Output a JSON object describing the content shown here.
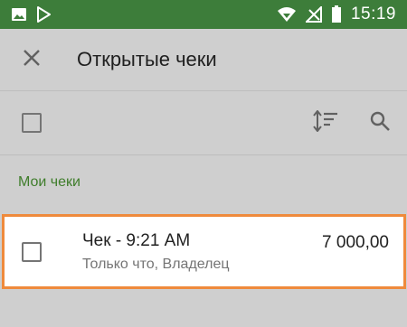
{
  "status_bar": {
    "time": "15:19",
    "icons_left": [
      "image-icon",
      "play-store-icon"
    ],
    "icons_right": [
      "wifi-icon",
      "no-signal-icon",
      "battery-icon"
    ],
    "background": "#3d7d3a"
  },
  "app_bar": {
    "title": "Открытые чеки",
    "close_icon": "close-icon"
  },
  "toolbar": {
    "select_all_icon": "checkbox-icon",
    "sort_icon": "sort-icon",
    "search_icon": "search-icon"
  },
  "section": {
    "title": "Мои чеки",
    "color": "#3f7d2b"
  },
  "receipts": [
    {
      "title": "Чек - 9:21 AM",
      "subtitle": "Только что, Владелец",
      "amount": "7 000,00",
      "highlight_color": "#ef8a3c"
    }
  ]
}
